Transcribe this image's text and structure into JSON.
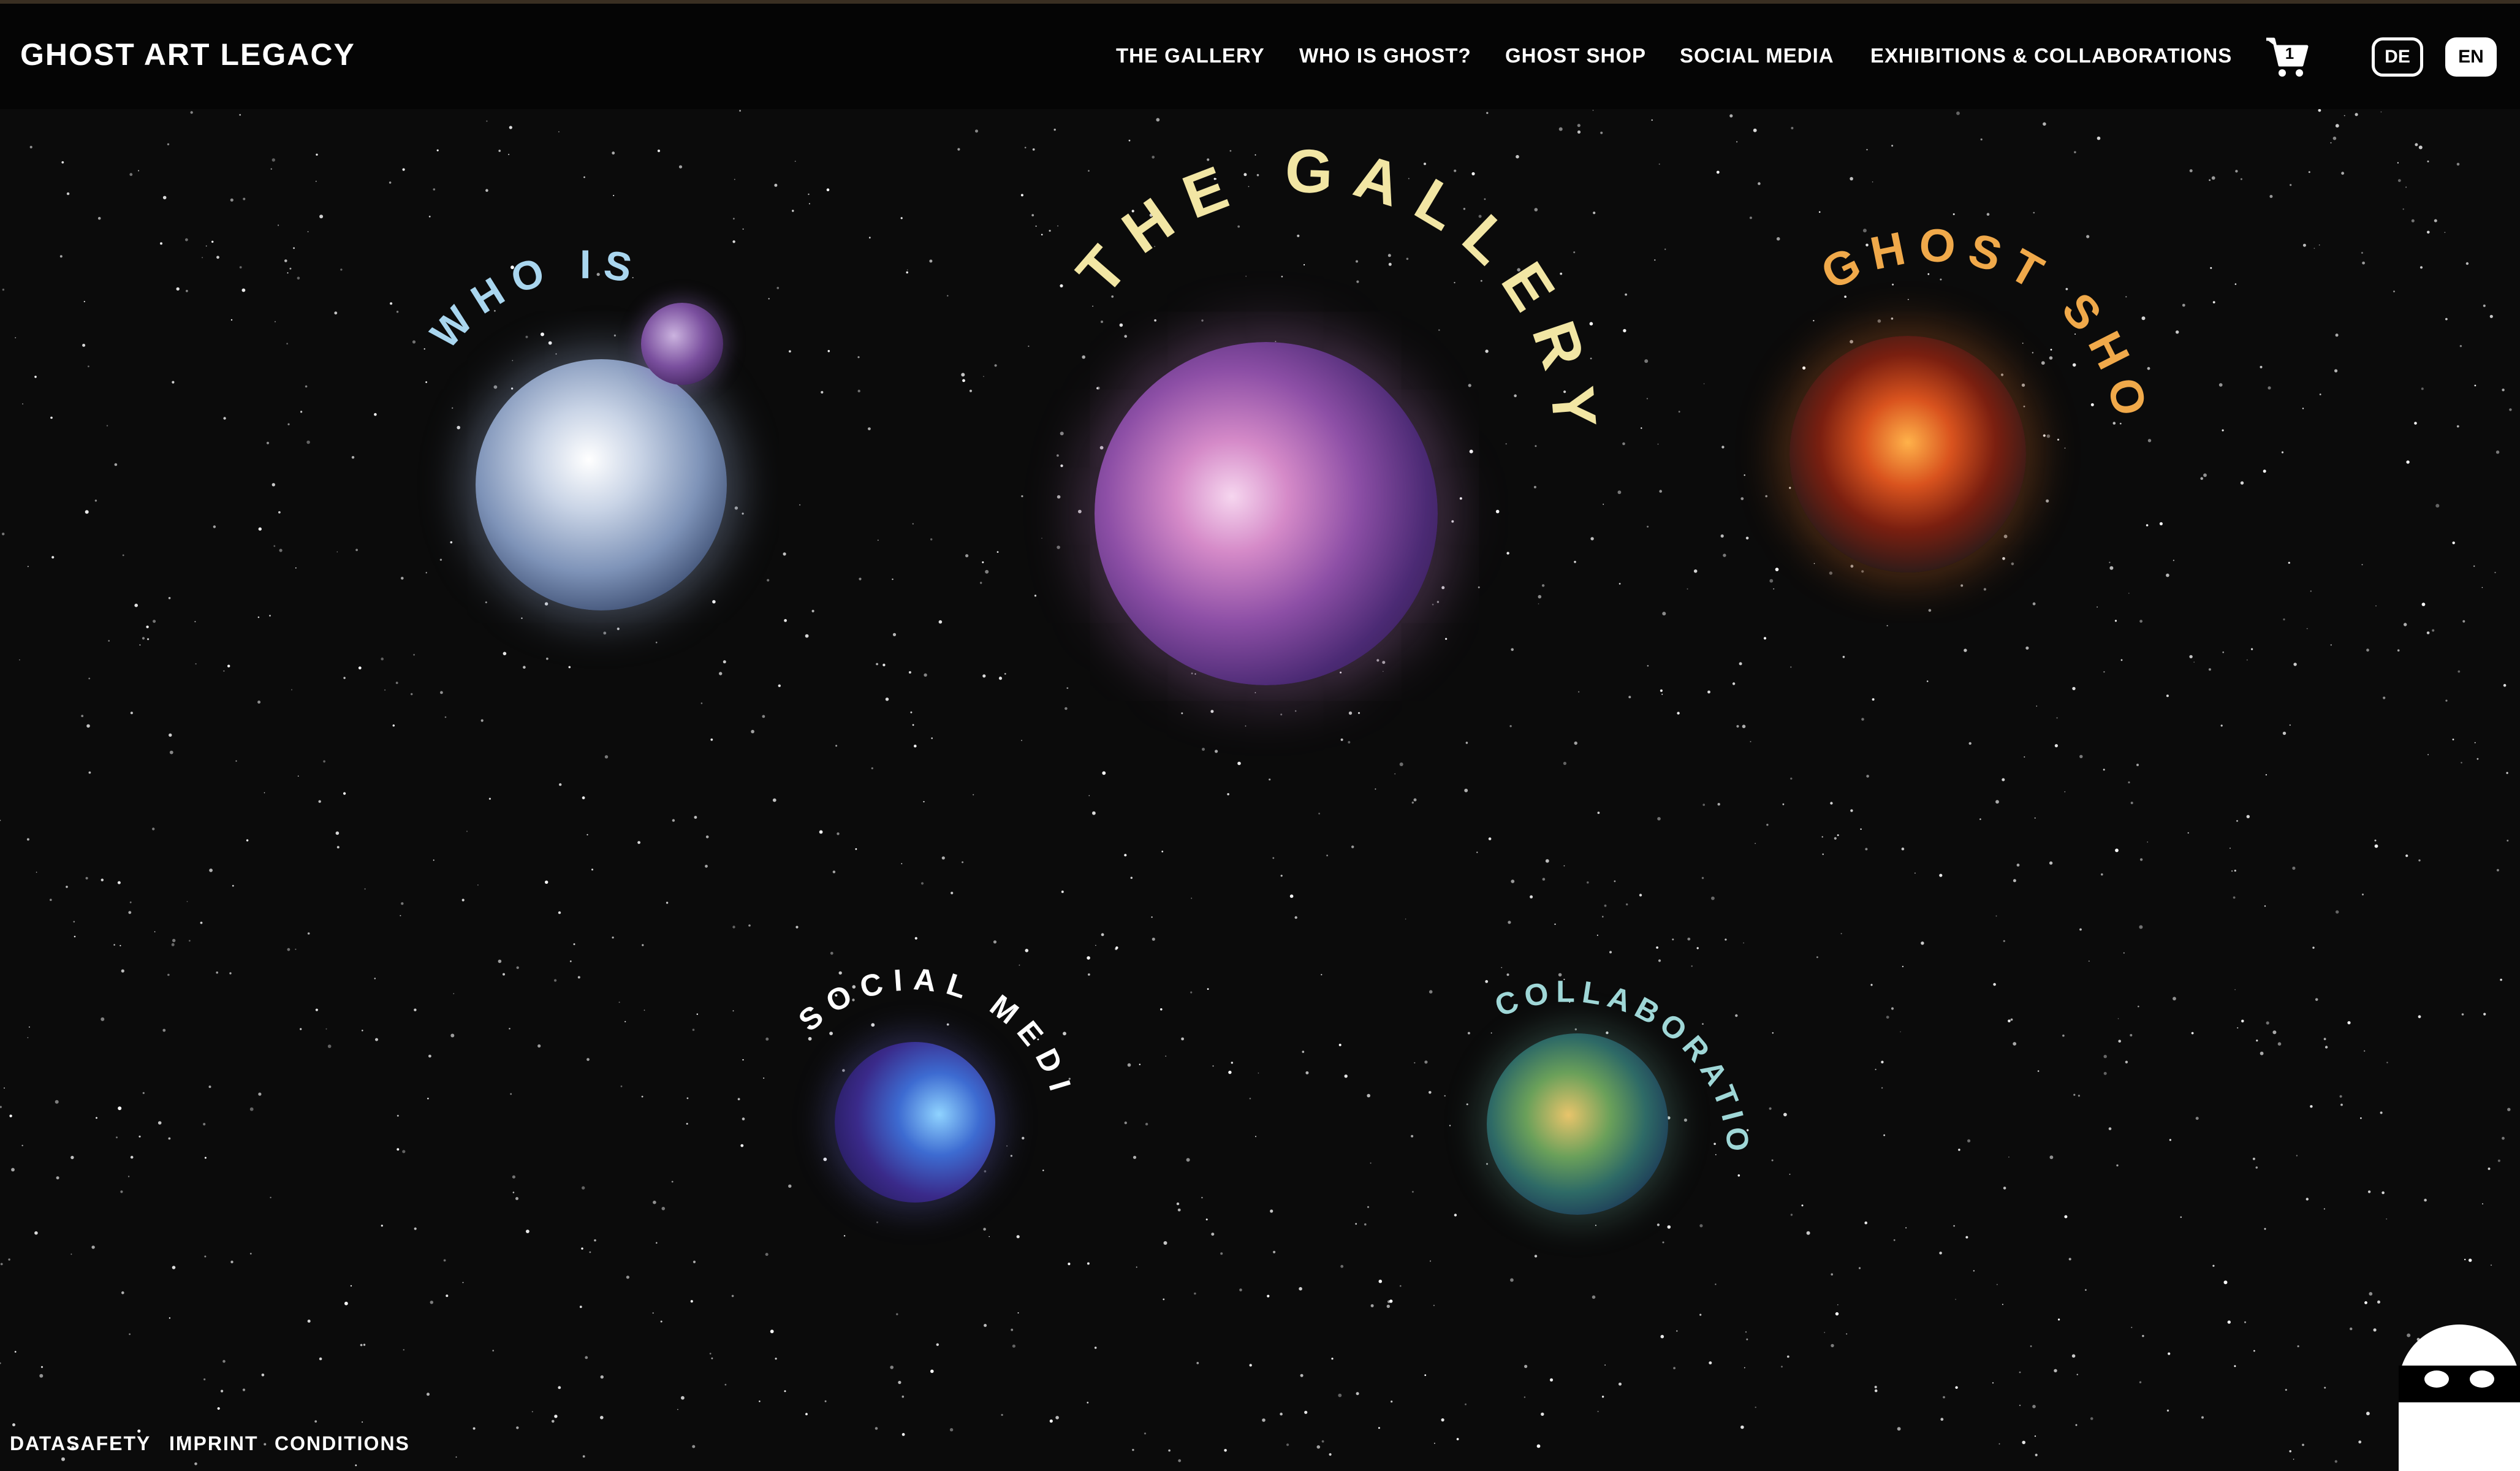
{
  "brand": "GHOST ART LEGACY",
  "nav": {
    "gallery": "THE GALLERY",
    "who": "WHO IS GHOST?",
    "shop": "GHOST SHOP",
    "social": "SOCIAL MEDIA",
    "exhibitions": "EXHIBITIONS & COLLABORATIONS"
  },
  "cart": {
    "count": "1"
  },
  "lang": {
    "de": "DE",
    "en": "EN",
    "active": "EN"
  },
  "planets": {
    "who": {
      "label": "WHO IS",
      "color": "#a9d6ef"
    },
    "gallery": {
      "label": "THE GALLERY",
      "color": "#f2e6a4"
    },
    "shop": {
      "label": "GHOST SHOP",
      "color": "#f0a94a"
    },
    "social": {
      "label": "SOCIAL MEDIA",
      "color": "#ffffff"
    },
    "collab": {
      "label": "COLLABORATIONS",
      "color": "#9fd7d7"
    }
  },
  "footer": {
    "datasafety": "DATASAFETY",
    "imprint": "IMPRINT",
    "conditions": "CONDITIONS"
  },
  "icons": {
    "cart": "shopping-cart-icon",
    "mascot": "ghost-mascot-icon"
  }
}
